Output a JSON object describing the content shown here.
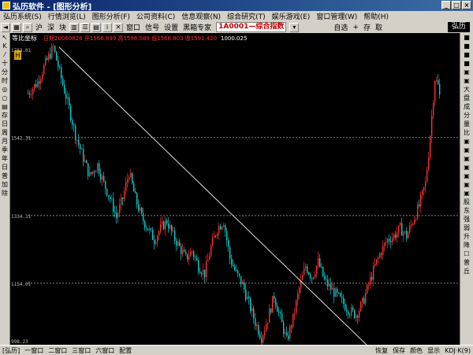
{
  "window": {
    "title": "弘历软件 - [图形分析]"
  },
  "menu": [
    "弘历系统(S)",
    "行情浏览(L)",
    "图形分析(F)",
    "公司资料(C)",
    "信息观察(N)",
    "综合研究(T)",
    "娱乐游戏(E)",
    "窗口管理(W)",
    "帮助(H)"
  ],
  "toolbar": {
    "left_labels": [
      "沪",
      "深",
      "块"
    ],
    "mid_labels": [
      "窗口",
      "信号",
      "设置",
      "黑箱专家"
    ],
    "stock": "1A0001—综合指数",
    "right_labels": [
      "自选",
      "+",
      "存",
      "取"
    ],
    "brand": "弘历"
  },
  "chart": {
    "indicator": "等比坐标",
    "info": "日期20060826 开1566.899 高1596.089 低1566.803 收1591.420",
    "value_top": "1000.025",
    "y_labels": [
      "1783.01",
      "1542.31",
      "1334.11",
      "1154.01",
      "998.23"
    ]
  },
  "chart_data": {
    "type": "candlestick",
    "y_ticks": [
      1783.01,
      1542.31,
      1334.11,
      1154.01,
      998.23
    ],
    "trendline": "descending white line from the early high to the lower right",
    "colors": {
      "up": "#ff3030",
      "down": "#00d0d0",
      "grid": "#808080",
      "trend": "#e0e0e0"
    },
    "price_path": [
      [
        0,
        1660
      ],
      [
        12,
        1690
      ],
      [
        22,
        1740
      ],
      [
        32,
        1783
      ],
      [
        42,
        1700
      ],
      [
        52,
        1620
      ],
      [
        60,
        1550
      ],
      [
        68,
        1500
      ],
      [
        78,
        1440
      ],
      [
        88,
        1470
      ],
      [
        96,
        1420
      ],
      [
        104,
        1380
      ],
      [
        112,
        1330
      ],
      [
        120,
        1380
      ],
      [
        128,
        1450
      ],
      [
        136,
        1380
      ],
      [
        144,
        1330
      ],
      [
        152,
        1300
      ],
      [
        160,
        1270
      ],
      [
        168,
        1300
      ],
      [
        176,
        1320
      ],
      [
        184,
        1280
      ],
      [
        192,
        1250
      ],
      [
        200,
        1220
      ],
      [
        208,
        1240
      ],
      [
        216,
        1200
      ],
      [
        224,
        1180
      ],
      [
        232,
        1250
      ],
      [
        240,
        1300
      ],
      [
        248,
        1320
      ],
      [
        256,
        1220
      ],
      [
        264,
        1180
      ],
      [
        272,
        1150
      ],
      [
        280,
        1100
      ],
      [
        288,
        1050
      ],
      [
        296,
        1010
      ],
      [
        304,
        1060
      ],
      [
        312,
        1120
      ],
      [
        320,
        1060
      ],
      [
        328,
        1000
      ],
      [
        336,
        1060
      ],
      [
        344,
        1140
      ],
      [
        352,
        1200
      ],
      [
        360,
        1170
      ],
      [
        368,
        1210
      ],
      [
        376,
        1160
      ],
      [
        384,
        1140
      ],
      [
        392,
        1120
      ],
      [
        400,
        1100
      ],
      [
        408,
        1080
      ],
      [
        416,
        1070
      ],
      [
        424,
        1100
      ],
      [
        432,
        1150
      ],
      [
        440,
        1200
      ],
      [
        448,
        1240
      ],
      [
        456,
        1270
      ],
      [
        464,
        1280
      ],
      [
        472,
        1300
      ],
      [
        480,
        1280
      ],
      [
        488,
        1320
      ],
      [
        496,
        1360
      ],
      [
        504,
        1420
      ],
      [
        508,
        1500
      ],
      [
        512,
        1600
      ],
      [
        516,
        1700
      ],
      [
        520,
        1680
      ],
      [
        523,
        1640
      ]
    ]
  },
  "leftbar": [
    "↖",
    "K",
    "⁄",
    "十",
    "分",
    "时",
    "◎",
    "○",
    "▤",
    "存",
    "日",
    "周",
    "月",
    "季",
    "年",
    "日",
    "普",
    "加",
    "除"
  ],
  "rightbar": [
    "■",
    "■",
    "■",
    "■",
    "▣",
    "▣",
    "大",
    "盘",
    "成",
    "分",
    "量",
    "比",
    "▣",
    "▣",
    "▣",
    "▣",
    "▣",
    "▣",
    "▣",
    "股",
    "东",
    "强",
    "弱",
    "升",
    "降",
    "☐",
    "普",
    "丘"
  ],
  "status": {
    "left": "[弘历]",
    "windows": [
      "一窗口",
      "二窗口",
      "三窗口",
      "六窗口",
      "配置"
    ],
    "right": [
      "恢复",
      "保存",
      "颜色",
      "显示",
      "KDJ·K(9)"
    ]
  }
}
